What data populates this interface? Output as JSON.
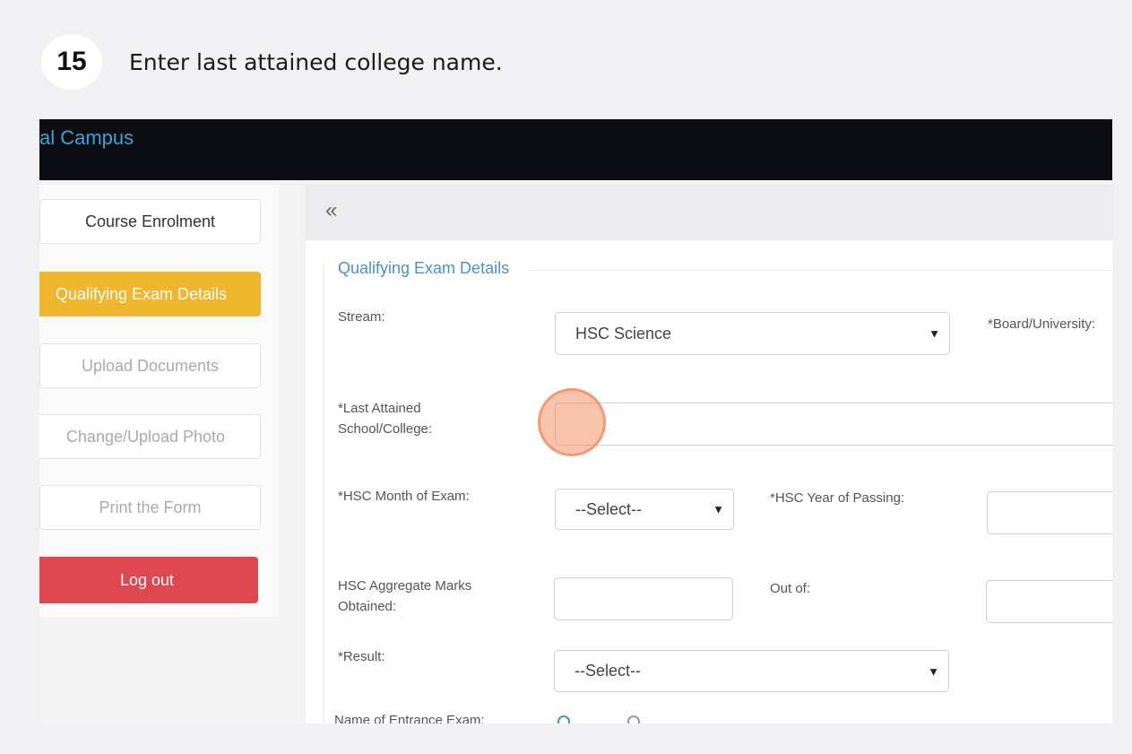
{
  "step": {
    "number": "15",
    "instruction": "Enter last attained college name."
  },
  "header": {
    "brand": "al Campus"
  },
  "sidebar": {
    "items": [
      {
        "label": "Course Enrolment"
      },
      {
        "label": "Qualifying Exam Details"
      },
      {
        "label": "Upload Documents"
      },
      {
        "label": "Change/Upload Photo"
      },
      {
        "label": "Print the Form"
      },
      {
        "label": "Log out"
      }
    ]
  },
  "main": {
    "collapse_icon": "«",
    "section_title": "Qualifying Exam Details",
    "fields": {
      "stream": {
        "label": "Stream:",
        "value": "HSC Science"
      },
      "board": {
        "label": "*Board/University:"
      },
      "last_school": {
        "label_line1": "*Last Attained",
        "label_line2": "School/College:",
        "value": ""
      },
      "hsc_month": {
        "label": "*HSC Month of Exam:",
        "value": "--Select--"
      },
      "hsc_year": {
        "label": "*HSC Year of Passing:",
        "value": ""
      },
      "hsc_marks": {
        "label_line1": "HSC Aggregate Marks",
        "label_line2": "Obtained:",
        "value": ""
      },
      "out_of": {
        "label": "Out of:",
        "value": ""
      },
      "result": {
        "label": "*Result:",
        "value": "--Select--"
      },
      "entrance": {
        "label": "Name of Entrance Exam:"
      }
    }
  },
  "colors": {
    "active_item": "#f0b62e",
    "logout": "#de4650",
    "topbar": "#0c0d12",
    "brand": "#3ba4d6",
    "highlight": "#f48f64"
  }
}
